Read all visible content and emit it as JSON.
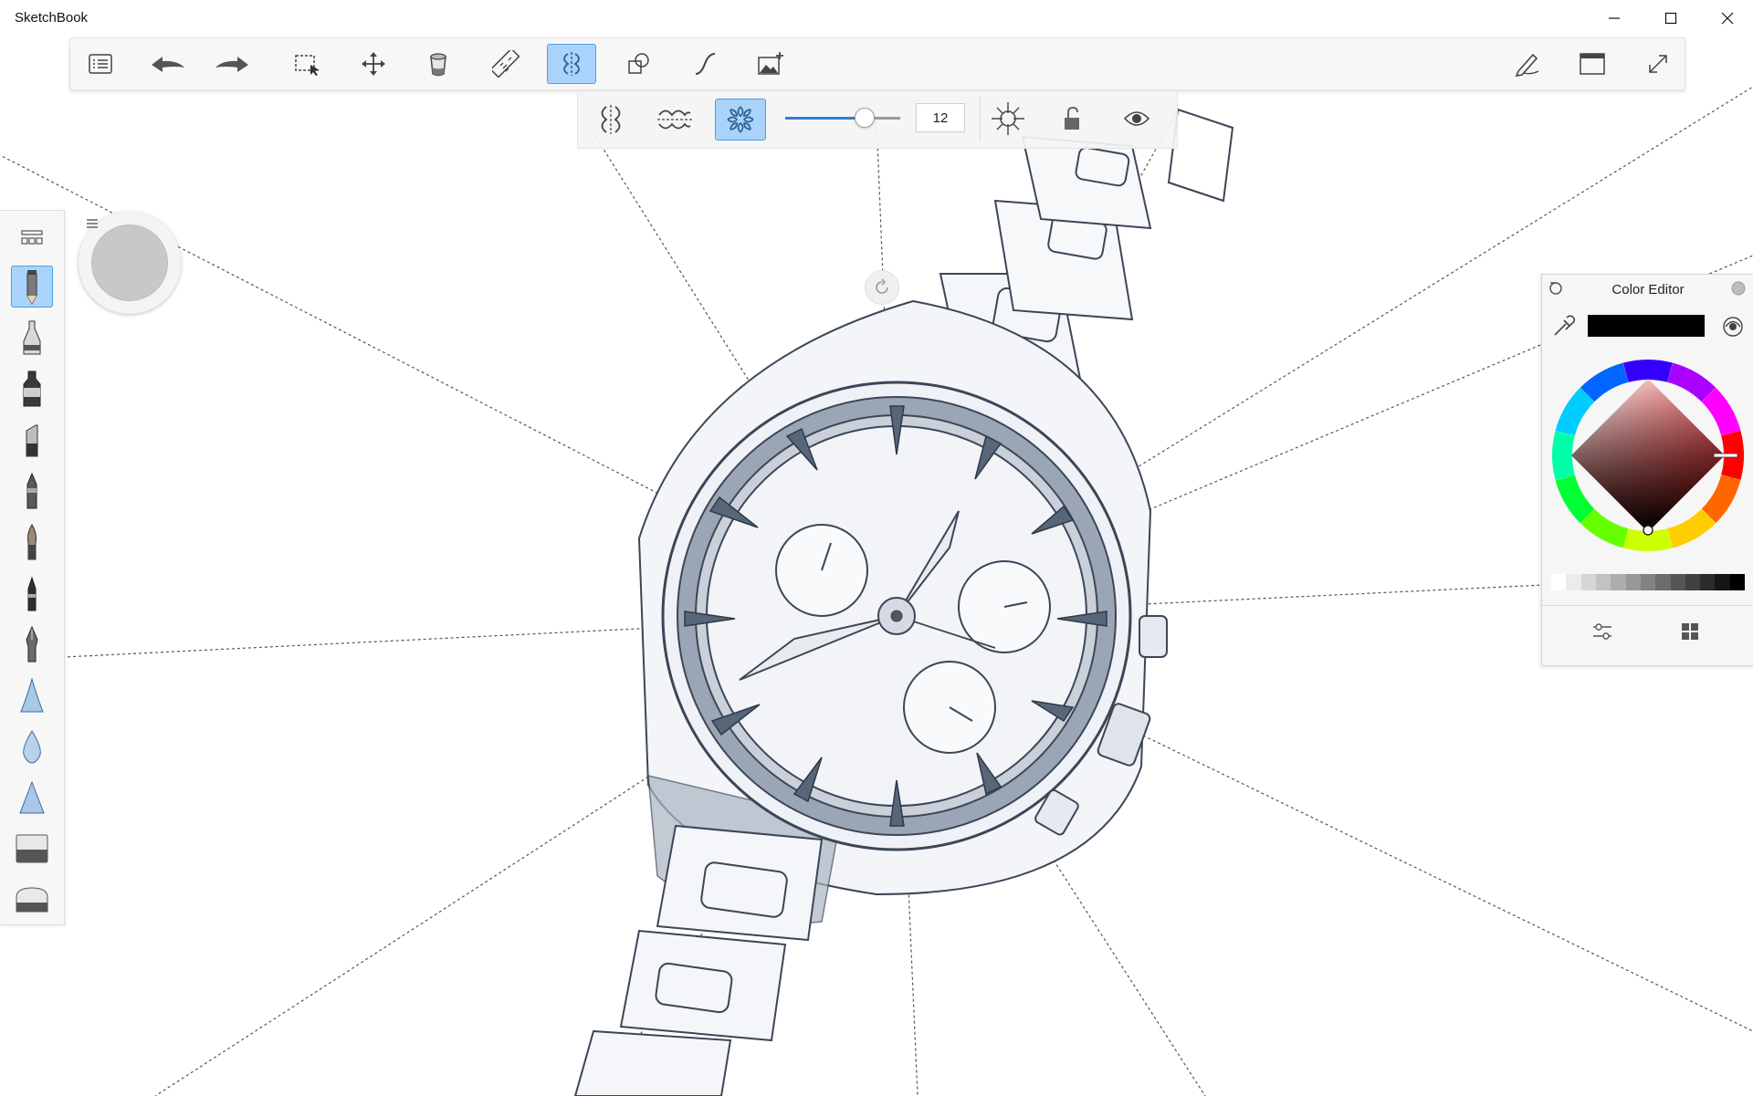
{
  "window": {
    "title": "SketchBook",
    "controls": [
      "minimize",
      "maximize",
      "close"
    ]
  },
  "toolbar": {
    "left_tools": [
      {
        "name": "brush-library-button",
        "icon": "list-icon"
      },
      {
        "name": "undo-button",
        "icon": "undo-arrow-icon"
      },
      {
        "name": "redo-button",
        "icon": "redo-arrow-icon"
      },
      {
        "name": "selection-button",
        "icon": "lasso-select-icon"
      },
      {
        "name": "transform-button",
        "icon": "move-arrows-icon"
      },
      {
        "name": "fill-button",
        "icon": "paint-bucket-icon"
      },
      {
        "name": "ruler-button",
        "icon": "ruler-icon"
      },
      {
        "name": "symmetry-button",
        "icon": "symmetry-icon",
        "active": true
      },
      {
        "name": "shapes-button",
        "icon": "shapes-icon"
      },
      {
        "name": "curve-button",
        "icon": "curve-icon"
      },
      {
        "name": "add-image-button",
        "icon": "add-image-icon"
      }
    ],
    "right_tools": [
      {
        "name": "pen-settings-button",
        "icon": "pen-icon"
      },
      {
        "name": "layout-button",
        "icon": "window-icon"
      },
      {
        "name": "fullscreen-button",
        "icon": "expand-icon"
      }
    ]
  },
  "symmetry_bar": {
    "modes": [
      {
        "name": "symmetry-x-button",
        "icon": "symmetry-vertical-icon"
      },
      {
        "name": "symmetry-y-button",
        "icon": "symmetry-horizontal-icon"
      },
      {
        "name": "symmetry-radial-button",
        "icon": "radial-symmetry-icon",
        "active": true
      }
    ],
    "sectors": {
      "value": 12,
      "fraction": 0.63
    },
    "sector_value": "12",
    "extra": [
      {
        "name": "symmetry-center-button",
        "icon": "crosshair-sun-icon"
      },
      {
        "name": "lock-button",
        "icon": "unlock-icon"
      },
      {
        "name": "visibility-button",
        "icon": "eye-icon"
      }
    ]
  },
  "brush_palette": {
    "items": [
      "pencil",
      "airbrush",
      "marker",
      "chisel-marker",
      "ballpoint-pen",
      "soft-brush",
      "fineliner",
      "ink-pen",
      "blue-triangle",
      "water-drop",
      "triangle-brush",
      "eraser-block",
      "eraser-round"
    ],
    "active": 0
  },
  "color_puck": {
    "color": "#c8c8c8"
  },
  "color_editor": {
    "title": "Color Editor",
    "current_color": "#000000",
    "grays": [
      "#ffffff",
      "#ececec",
      "#d6d6d6",
      "#c2c2c2",
      "#adadad",
      "#979797",
      "#838383",
      "#6c6c6c",
      "#565656",
      "#414141",
      "#2b2b2b",
      "#151515",
      "#000000"
    ]
  },
  "colors": {
    "accent": "#4d9fe8",
    "active_bg": "#a9d3fa",
    "panel_bg": "#f7f7f7"
  }
}
